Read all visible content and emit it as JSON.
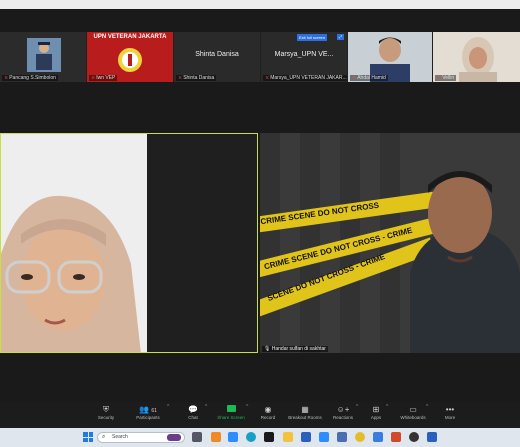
{
  "gallery": {
    "participants": [
      {
        "name": "Pancang S.Simbolon",
        "muted": true
      },
      {
        "name": "Iwn VEP",
        "muted": true,
        "banner_title": "UPN VETERAN JAKARTA"
      },
      {
        "name": "Shinta Danisa",
        "muted": true,
        "center_label": "Shinta Danisa"
      },
      {
        "name": "Marsya_UPN VETERAN JAKAR...",
        "muted": true,
        "center_label": "Marsya_UPN VE...",
        "badge": "Exit full screen"
      },
      {
        "name": "Ahdal Hamid",
        "muted": true
      },
      {
        "name": "Vellin",
        "muted": true
      }
    ]
  },
  "main": {
    "right_name": "Handar sulfan di sakhtar",
    "tape_lines": [
      "CRIME SCENE DO NOT CROSS",
      "CRIME SCENE DO NOT CROSS - CRIME",
      "SCENE DO NOT CROSS - CRIME"
    ]
  },
  "toolbar": {
    "buttons": [
      {
        "label": "Security",
        "icon": "shield-icon"
      },
      {
        "label": "Participants",
        "icon": "participants-icon",
        "count": "61"
      },
      {
        "label": "Chat",
        "icon": "chat-icon"
      },
      {
        "label": "Share Screen",
        "icon": "share-screen-icon"
      },
      {
        "label": "Record",
        "icon": "record-icon"
      },
      {
        "label": "Breakout Rooms",
        "icon": "breakout-icon"
      },
      {
        "label": "Reactions",
        "icon": "reactions-icon"
      },
      {
        "label": "Apps",
        "icon": "apps-icon"
      },
      {
        "label": "Whiteboards",
        "icon": "whiteboard-icon"
      },
      {
        "label": "More",
        "icon": "more-icon"
      }
    ]
  },
  "taskbar": {
    "search_placeholder": "Search"
  }
}
